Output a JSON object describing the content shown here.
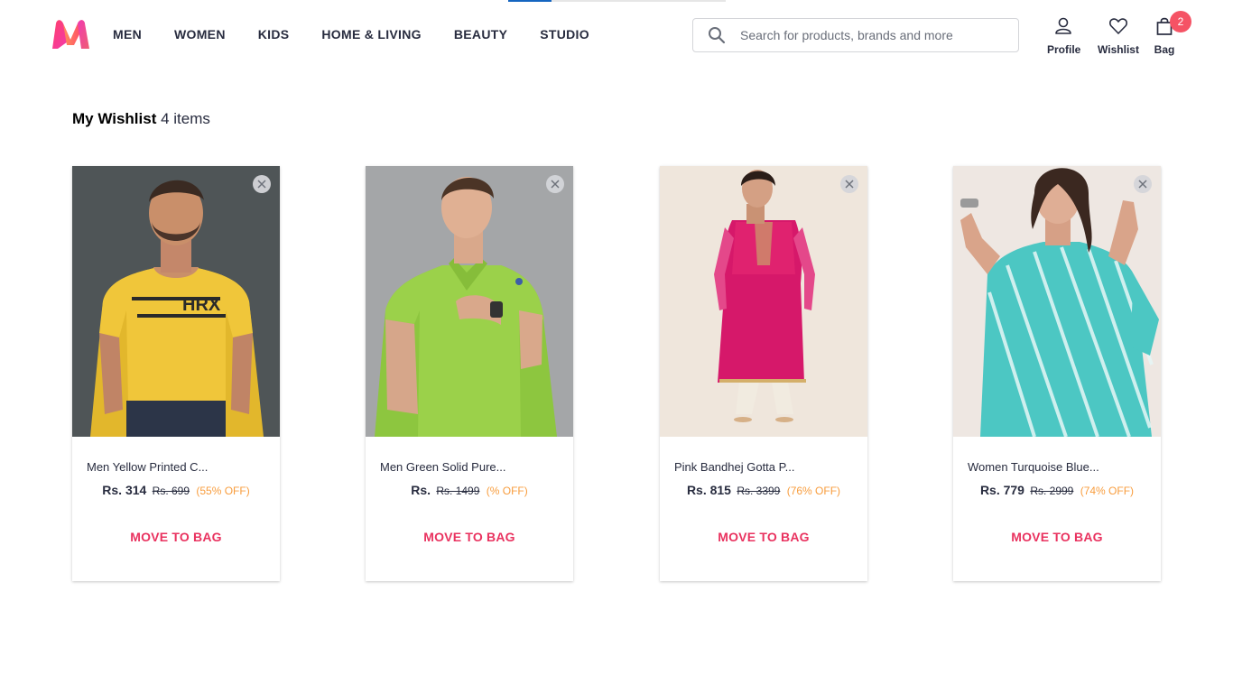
{
  "header": {
    "logo_icon": "myntra-logo-icon",
    "nav": [
      "MEN",
      "WOMEN",
      "KIDS",
      "HOME & LIVING",
      "BEAUTY",
      "STUDIO"
    ],
    "search_placeholder": "Search for products, brands and more",
    "search_icon": "search-icon",
    "actions": {
      "profile_label": "Profile",
      "wishlist_label": "Wishlist",
      "bag_label": "Bag",
      "bag_count": "2"
    }
  },
  "wishlist": {
    "title": "My Wishlist",
    "count_text": "4 items",
    "move_label": "MOVE TO BAG",
    "items": [
      {
        "name": "Men Yellow Printed C...",
        "price": "Rs. 314",
        "mrp": "Rs. 699",
        "discount": "(55% OFF)",
        "image": "man-in-yellow-hrx-tshirt"
      },
      {
        "name": "Men Green Solid Pure...",
        "price": "Rs.",
        "mrp": "Rs. 1499",
        "discount": "(% OFF)",
        "image": "man-in-green-polo-tshirt"
      },
      {
        "name": "Pink Bandhej Gotta P...",
        "price": "Rs. 815",
        "mrp": "Rs. 3399",
        "discount": "(76% OFF)",
        "image": "woman-in-pink-kurta"
      },
      {
        "name": "Women Turquoise Blue...",
        "price": "Rs. 779",
        "mrp": "Rs. 2999",
        "discount": "(74% OFF)",
        "image": "woman-in-turquoise-kurta"
      }
    ]
  },
  "colors": {
    "accent": "#ff3f6c",
    "move_to_bag": "#e9325f",
    "discount": "#f89d3e",
    "badge": "#f55365"
  }
}
